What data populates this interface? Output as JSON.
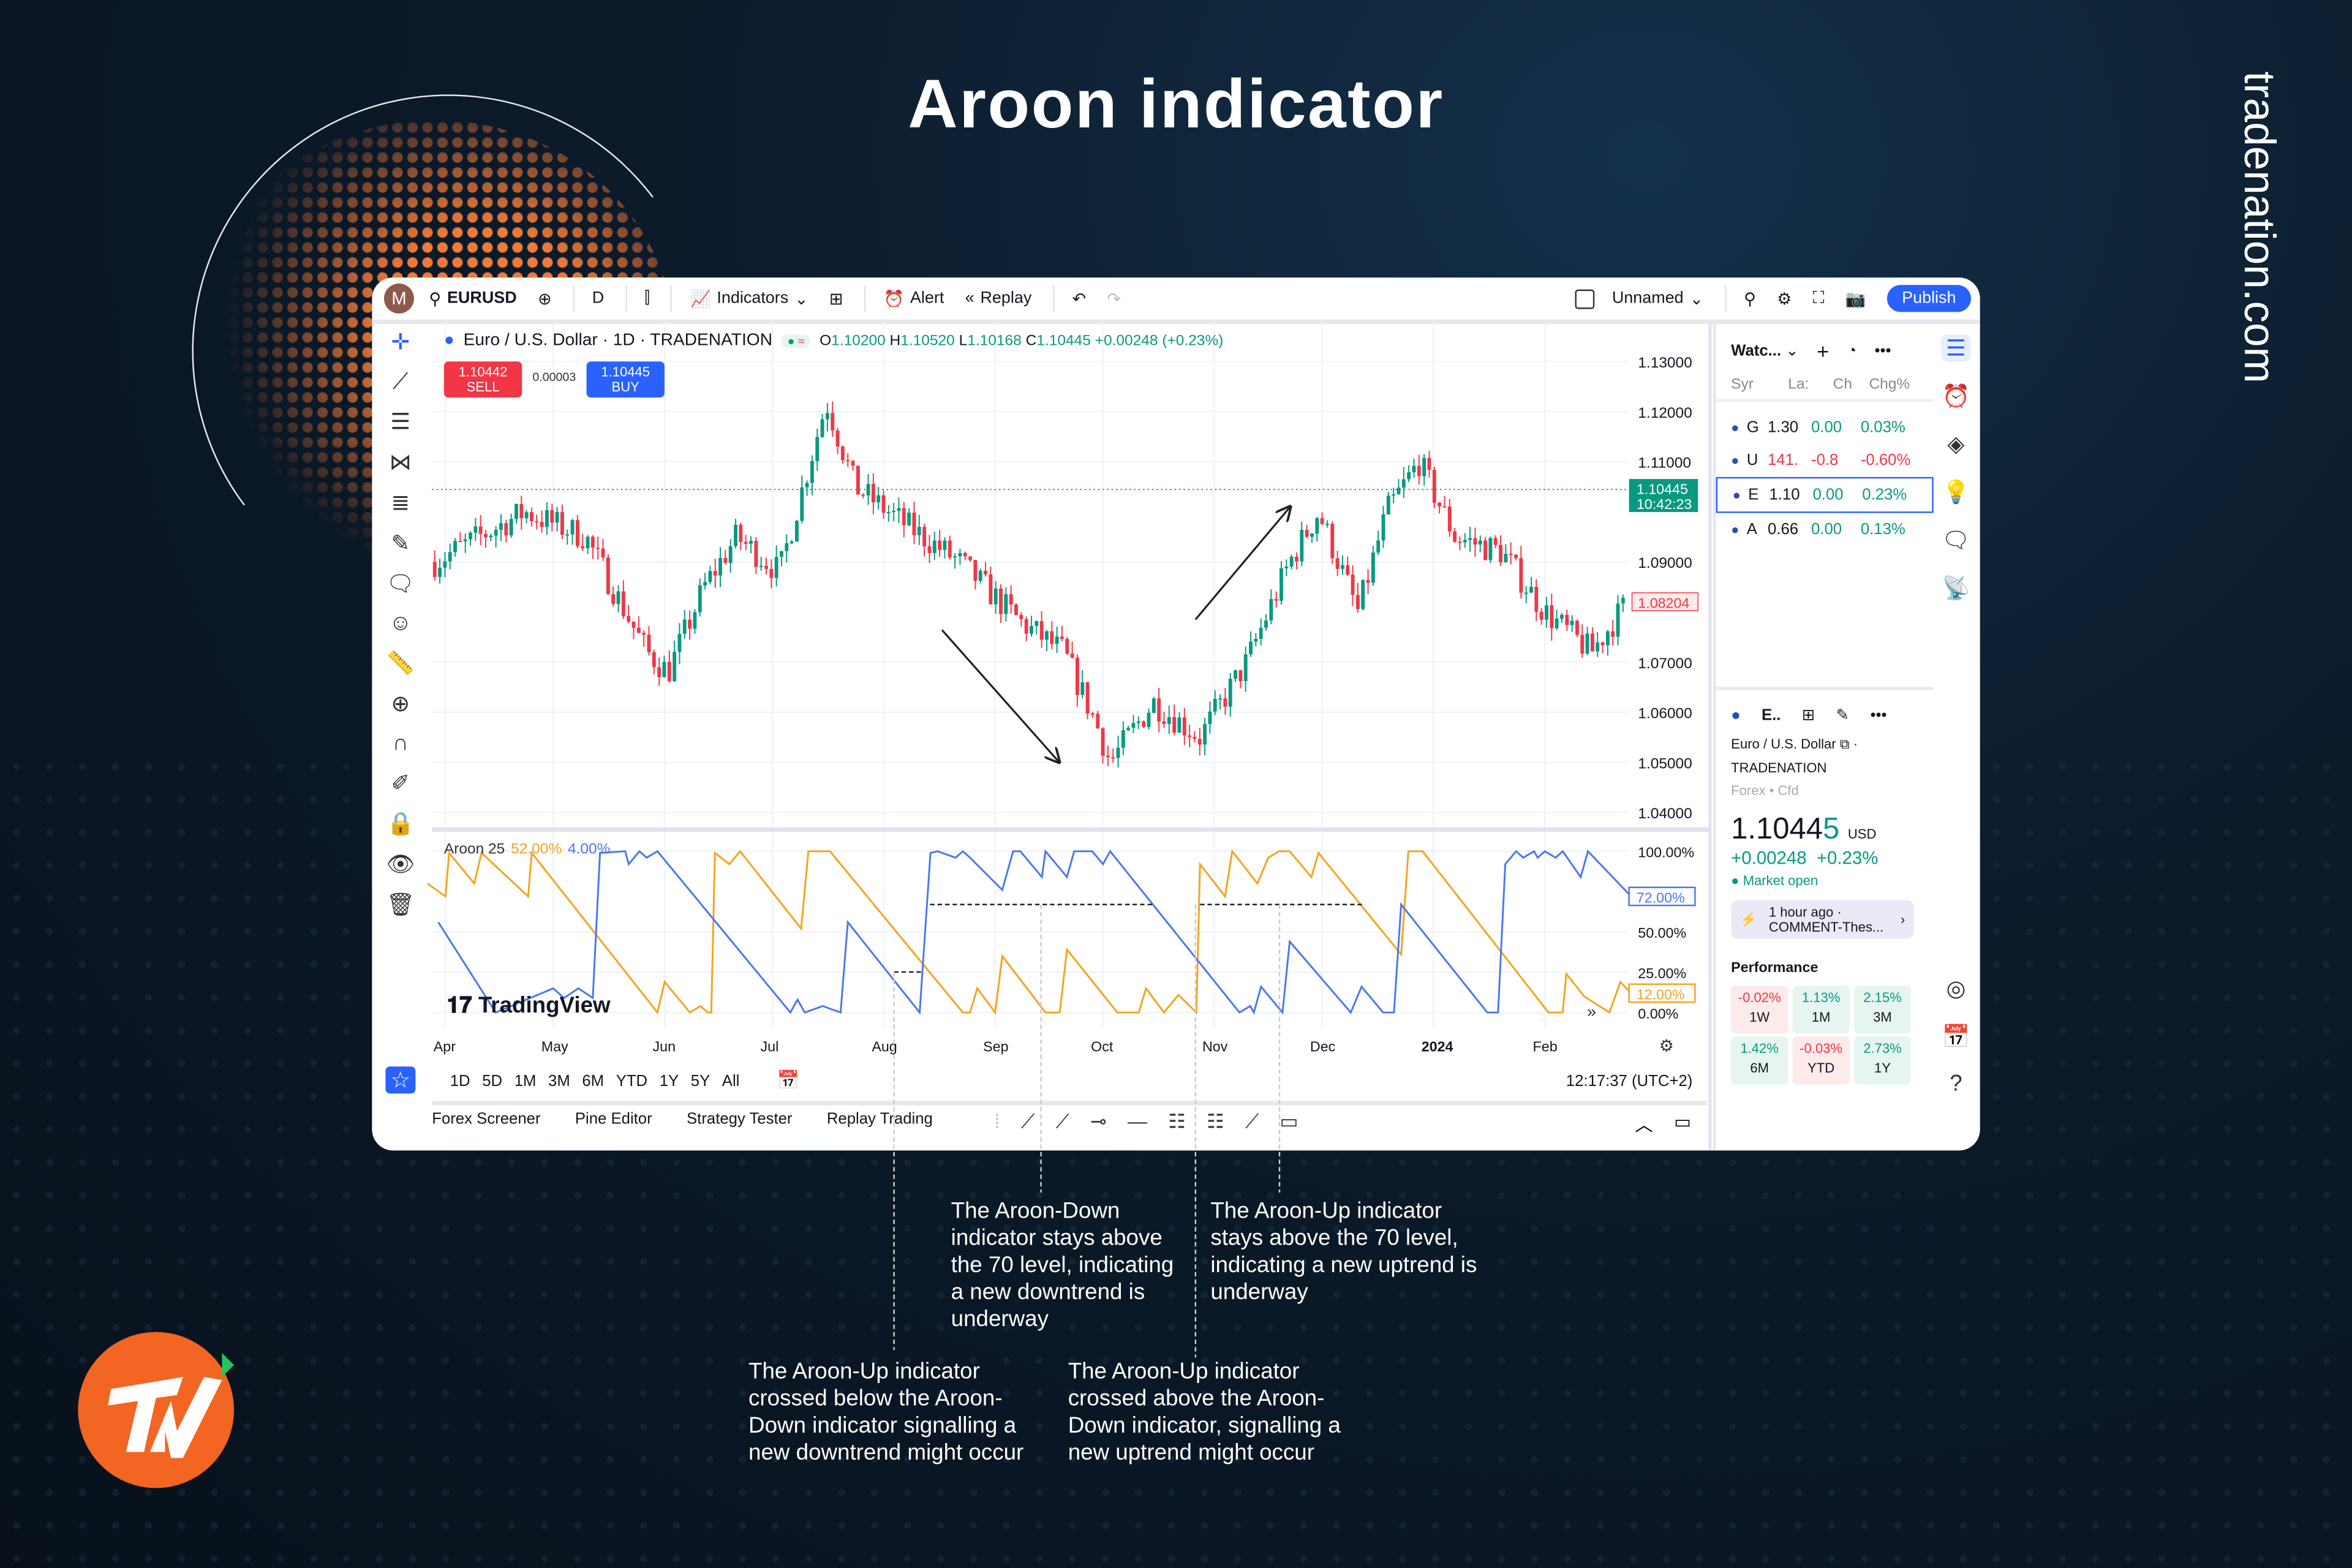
{
  "page": {
    "title": "Aroon indicator",
    "brand": "tradenation.com",
    "logo": "TN"
  },
  "toolbar": {
    "avatar": "M",
    "symbol": "EURUSD",
    "interval": "D",
    "indicators": "Indicators",
    "alert": "Alert",
    "replay": "Replay",
    "layout_name": "Unnamed",
    "publish": "Publish"
  },
  "chart_header": {
    "title": "Euro / U.S. Dollar · 1D · TRADENATION",
    "o_label": "O",
    "o": "1.10200",
    "h_label": "H",
    "h": "1.10520",
    "l_label": "L",
    "l": "1.10168",
    "c_label": "C",
    "c": "1.10445",
    "change": "+0.00248 (+0.23%)"
  },
  "trade": {
    "sell_price": "1.10442",
    "sell_label": "SELL",
    "spread": "0.00003",
    "buy_price": "1.10445",
    "buy_label": "BUY"
  },
  "price_axis": {
    "ticks": [
      "1.13000",
      "1.12000",
      "1.11000",
      "1.09000",
      "1.07000",
      "1.06000",
      "1.05000",
      "1.04000"
    ],
    "tick_values": [
      1.13,
      1.12,
      1.11,
      1.09,
      1.07,
      1.06,
      1.05,
      1.04
    ],
    "last_price": "1.10445",
    "countdown": "10:42:23",
    "marker": "1.08204",
    "marker_value": 1.08204
  },
  "indicator": {
    "name": "Aroon 25",
    "up_value": "52.00%",
    "down_value": "4.00%",
    "axis": [
      "100.00%",
      "50.00%",
      "25.00%",
      "0.00%"
    ],
    "axis_values": [
      100,
      50,
      25,
      0
    ],
    "up_last": "12.00%",
    "down_last": "72.00%",
    "up_color": "#f7a21b",
    "down_color": "#4a76f0"
  },
  "time_axis": [
    "Apr",
    "May",
    "Jun",
    "Jul",
    "Aug",
    "Sep",
    "Oct",
    "Nov",
    "Dec",
    "2024",
    "Feb"
  ],
  "time_axis_dates": [
    "2023-04-01",
    "2023-05-01",
    "2023-06-01",
    "2023-07-01",
    "2023-08-01",
    "2023-09-01",
    "2023-10-01",
    "2023-11-01",
    "2023-12-01",
    "2024-01-01",
    "2024-02-01"
  ],
  "watermark": "TradingView",
  "range_bar": {
    "ranges": [
      "1D",
      "5D",
      "1M",
      "3M",
      "6M",
      "YTD",
      "1Y",
      "5Y",
      "All"
    ],
    "clock": "12:17:37 (UTC+2)"
  },
  "bottom_tabs": [
    "Forex Screener",
    "Pine Editor",
    "Strategy Tester",
    "Replay Trading"
  ],
  "watchlist": {
    "title": "Watc...",
    "columns": [
      "Syr",
      "La:",
      "Ch",
      "Chg%"
    ],
    "rows": [
      {
        "sym": "G",
        "last": "1.30",
        "chg": "0.00",
        "pct": "0.03%",
        "dir": "up"
      },
      {
        "sym": "U",
        "last": "141.",
        "chg": "-0.8",
        "pct": "-0.60%",
        "dir": "down"
      },
      {
        "sym": "E",
        "last": "1.10",
        "chg": "0.00",
        "pct": "0.23%",
        "dir": "up",
        "selected": true
      },
      {
        "sym": "A",
        "last": "0.66",
        "chg": "0.00",
        "pct": "0.13%",
        "dir": "up"
      }
    ]
  },
  "details": {
    "short": "E..",
    "name": "Euro / U.S. Dollar",
    "exchange": "TRADENATION",
    "type": "Forex • Cfd",
    "price_main": "1.1044",
    "price_last": "5",
    "currency": "USD",
    "change": "+0.00248  +0.23%",
    "status": "Market open",
    "news_time": "1 hour ago ·",
    "news_title": "COMMENT-Thes...",
    "performance_title": "Performance",
    "performance": [
      {
        "v": "-0.02%",
        "p": "1W",
        "dir": "down"
      },
      {
        "v": "1.13%",
        "p": "1M",
        "dir": "up"
      },
      {
        "v": "2.15%",
        "p": "3M",
        "dir": "up"
      },
      {
        "v": "1.42%",
        "p": "6M",
        "dir": "up"
      },
      {
        "v": "-0.03%",
        "p": "YTD",
        "dir": "down"
      },
      {
        "v": "2.73%",
        "p": "1Y",
        "dir": "up"
      }
    ]
  },
  "annotations": [
    "The Aroon-Down indicator stays above the 70 level, indicating a new downtrend is underway",
    "The Aroon-Up indicator stays above the 70 level, indicating a new uptrend is underway",
    "The Aroon-Up indicator crossed below the Aroon-Down indicator signalling a new downtrend might occur",
    "The Aroon-Up indicator crossed above the Aroon-Down indicator, signalling a new uptrend might occur"
  ],
  "colors": {
    "up": "#089981",
    "down": "#f23645",
    "accent": "#2962ff",
    "orange": "#f26522"
  },
  "chart_data": {
    "type": "candlestick+line",
    "price_range": [
      1.04,
      1.13
    ],
    "aroon_range": [
      0,
      100
    ],
    "price_path": [
      [
        "2023-03-29",
        1.09
      ],
      [
        "2023-04-23",
        1.1
      ],
      [
        "2023-05-10",
        1.095
      ],
      [
        "2023-05-27",
        1.072
      ],
      [
        "2023-06-02",
        1.068
      ],
      [
        "2023-06-12",
        1.085
      ],
      [
        "2023-06-21",
        1.095
      ],
      [
        "2023-07-03",
        1.088
      ],
      [
        "2023-07-16",
        1.122
      ],
      [
        "2023-07-24",
        1.105
      ],
      [
        "2023-08-06",
        1.098
      ],
      [
        "2023-08-22",
        1.09
      ],
      [
        "2023-09-08",
        1.078
      ],
      [
        "2023-09-20",
        1.072
      ],
      [
        "2023-09-29",
        1.058
      ],
      [
        "2023-10-03",
        1.05
      ],
      [
        "2023-10-15",
        1.062
      ],
      [
        "2023-10-28",
        1.055
      ],
      [
        "2023-11-10",
        1.07
      ],
      [
        "2023-11-22",
        1.09
      ],
      [
        "2023-11-30",
        1.1
      ],
      [
        "2023-12-11",
        1.08
      ],
      [
        "2023-12-19",
        1.1
      ],
      [
        "2023-12-28",
        1.11
      ],
      [
        "2024-01-07",
        1.095
      ],
      [
        "2024-01-20",
        1.092
      ],
      [
        "2024-02-01",
        1.08
      ],
      [
        "2024-02-14",
        1.072
      ],
      [
        "2024-02-24",
        1.082
      ]
    ],
    "aroon_up": [
      [
        "2023-03-27",
        80
      ],
      [
        "2023-04-01",
        72
      ],
      [
        "2023-04-02",
        99
      ],
      [
        "2023-04-09",
        80
      ],
      [
        "2023-04-11",
        99
      ],
      [
        "2023-04-24",
        72
      ],
      [
        "2023-04-25",
        99
      ],
      [
        "2023-05-30",
        0
      ],
      [
        "2023-06-01",
        19
      ],
      [
        "2023-06-08",
        0
      ],
      [
        "2023-06-11",
        4
      ],
      [
        "2023-06-13",
        0
      ],
      [
        "2023-06-14",
        0
      ],
      [
        "2023-06-15",
        99
      ],
      [
        "2023-06-19",
        92
      ],
      [
        "2023-06-22",
        100
      ],
      [
        "2023-07-09",
        52
      ],
      [
        "2023-07-11",
        100
      ],
      [
        "2023-07-17",
        100
      ],
      [
        "2023-08-23",
        0
      ],
      [
        "2023-08-25",
        0
      ],
      [
        "2023-08-27",
        15
      ],
      [
        "2023-09-01",
        0
      ],
      [
        "2023-09-03",
        35
      ],
      [
        "2023-09-15",
        0
      ],
      [
        "2023-09-19",
        0
      ],
      [
        "2023-09-21",
        39
      ],
      [
        "2023-10-05",
        0
      ],
      [
        "2023-10-11",
        0
      ],
      [
        "2023-10-13",
        15
      ],
      [
        "2023-10-18",
        0
      ],
      [
        "2023-10-22",
        11
      ],
      [
        "2023-10-27",
        0
      ],
      [
        "2023-10-28",
        92
      ],
      [
        "2023-11-04",
        72
      ],
      [
        "2023-11-06",
        100
      ],
      [
        "2023-11-13",
        80
      ],
      [
        "2023-11-16",
        96
      ],
      [
        "2023-11-19",
        100
      ],
      [
        "2023-11-22",
        100
      ],
      [
        "2023-11-28",
        84
      ],
      [
        "2023-11-30",
        99
      ],
      [
        "2023-12-23",
        36
      ],
      [
        "2023-12-25",
        100
      ],
      [
        "2023-12-29",
        100
      ],
      [
        "2024-02-02",
        0
      ],
      [
        "2024-02-06",
        0
      ],
      [
        "2024-02-07",
        24
      ],
      [
        "2024-02-12",
        10
      ],
      [
        "2024-02-19",
        0
      ],
      [
        "2024-02-22",
        19
      ],
      [
        "2024-02-25",
        12
      ]
    ],
    "aroon_down": [
      [
        "2023-03-30",
        56
      ],
      [
        "2023-04-15",
        0
      ],
      [
        "2023-05-01",
        15
      ],
      [
        "2023-05-04",
        9
      ],
      [
        "2023-05-08",
        15
      ],
      [
        "2023-05-12",
        9
      ],
      [
        "2023-05-14",
        99
      ],
      [
        "2023-05-21",
        100
      ],
      [
        "2023-05-22",
        92
      ],
      [
        "2023-05-25",
        100
      ],
      [
        "2023-05-27",
        96
      ],
      [
        "2023-05-30",
        100
      ],
      [
        "2023-07-06",
        0
      ],
      [
        "2023-07-08",
        8
      ],
      [
        "2023-07-10",
        0
      ],
      [
        "2023-07-15",
        4
      ],
      [
        "2023-07-20",
        0
      ],
      [
        "2023-07-22",
        56
      ],
      [
        "2023-08-11",
        0
      ],
      [
        "2023-08-14",
        99
      ],
      [
        "2023-08-16",
        100
      ],
      [
        "2023-08-21",
        96
      ],
      [
        "2023-08-23",
        100
      ],
      [
        "2023-08-25",
        96
      ],
      [
        "2023-09-03",
        76
      ],
      [
        "2023-09-06",
        100
      ],
      [
        "2023-09-08",
        100
      ],
      [
        "2023-09-14",
        84
      ],
      [
        "2023-09-15",
        100
      ],
      [
        "2023-09-21",
        84
      ],
      [
        "2023-09-23",
        100
      ],
      [
        "2023-09-28",
        100
      ],
      [
        "2023-10-01",
        92
      ],
      [
        "2023-10-03",
        100
      ],
      [
        "2023-11-08",
        0
      ],
      [
        "2023-11-11",
        4
      ],
      [
        "2023-11-12",
        0
      ],
      [
        "2023-11-14",
        16
      ],
      [
        "2023-11-20",
        0
      ],
      [
        "2023-11-22",
        44
      ],
      [
        "2023-12-09",
        0
      ],
      [
        "2023-12-12",
        16
      ],
      [
        "2023-12-18",
        0
      ],
      [
        "2023-12-21",
        0
      ],
      [
        "2023-12-23",
        67
      ],
      [
        "2024-01-16",
        0
      ],
      [
        "2024-01-19",
        0
      ],
      [
        "2024-01-21",
        92
      ],
      [
        "2024-01-24",
        100
      ],
      [
        "2024-01-26",
        96
      ],
      [
        "2024-01-29",
        100
      ],
      [
        "2024-01-30",
        96
      ],
      [
        "2024-02-01",
        100
      ],
      [
        "2024-02-04",
        96
      ],
      [
        "2024-02-06",
        100
      ],
      [
        "2024-02-11",
        84
      ],
      [
        "2024-02-13",
        100
      ],
      [
        "2024-02-25",
        72
      ]
    ]
  }
}
